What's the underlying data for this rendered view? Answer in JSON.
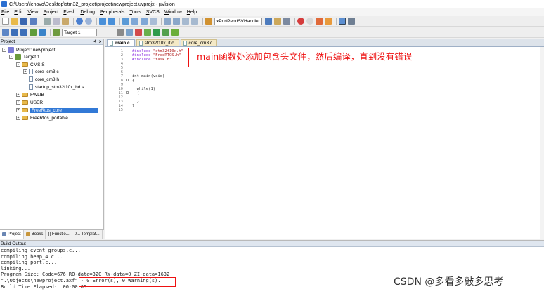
{
  "window": {
    "title": "C:\\Users\\lenovo\\Desktop\\stm32_project\\project\\newproject.uvprojx - µVision"
  },
  "menu": [
    "File",
    "Edit",
    "View",
    "Project",
    "Flash",
    "Debug",
    "Peripherals",
    "Tools",
    "SVCS",
    "Window",
    "Help"
  ],
  "toolbar": {
    "function_combo": "xPortPendSVHandler",
    "target_combo": "Target 1"
  },
  "project_panel": {
    "title": "Project",
    "pin": "4",
    "close": "x",
    "tree": [
      {
        "label": "Project: newproject",
        "level": 0,
        "kind": "project",
        "expander": "-"
      },
      {
        "label": "Target 1",
        "level": 1,
        "kind": "target",
        "expander": "-"
      },
      {
        "label": "CMSIS",
        "level": 2,
        "kind": "folder",
        "expander": "-"
      },
      {
        "label": "core_cm3.c",
        "level": 3,
        "kind": "file",
        "expander": "+"
      },
      {
        "label": "core_cm3.h",
        "level": 3,
        "kind": "file",
        "expander": ""
      },
      {
        "label": "startup_stm32f10x_hd.s",
        "level": 3,
        "kind": "file",
        "expander": ""
      },
      {
        "label": "FWLIB",
        "level": 2,
        "kind": "folder",
        "expander": "+"
      },
      {
        "label": "USER",
        "level": 2,
        "kind": "folder",
        "expander": "+"
      },
      {
        "label": "FreeRtos_core",
        "level": 2,
        "kind": "folder",
        "expander": "+",
        "selected": true
      },
      {
        "label": "FreeRtos_portable",
        "level": 2,
        "kind": "folder",
        "expander": "+"
      }
    ],
    "tabs": [
      "Project",
      "Books",
      "{} Functio...",
      "0... Templat..."
    ]
  },
  "editor": {
    "tabs": [
      {
        "label": "main.c",
        "active": true
      },
      {
        "label": "stm32f10x_it.c",
        "active": false
      },
      {
        "label": "core_cm3.c",
        "active": false
      }
    ],
    "line_numbers": [
      "1",
      "2",
      "3",
      "4",
      "5",
      "6",
      "7",
      "8",
      "9",
      "10",
      "11",
      "12",
      "13",
      "14",
      "15"
    ],
    "code": [
      {
        "pp": "#include",
        "str": " \"stm32f10x.h\""
      },
      {
        "pp": "#include",
        "str": " \"FreeRTOS.h\""
      },
      {
        "pp": "#include",
        "str": " \"task.h\""
      },
      {
        "text": ""
      },
      {
        "text": ""
      },
      {
        "text": ""
      },
      {
        "text": "int main(void)"
      },
      {
        "text": "{"
      },
      {
        "text": ""
      },
      {
        "text": "  while(1)"
      },
      {
        "text": "  {"
      },
      {
        "text": ""
      },
      {
        "text": "  }"
      },
      {
        "text": "}"
      },
      {
        "text": ""
      }
    ]
  },
  "annotation": "main函数处添加包含头文件，然后编译，直到没有错误",
  "build_output": {
    "title": "Build Output",
    "lines": [
      "compiling event_groups.c...",
      "compiling heap_4.c...",
      "compiling port.c...",
      "linking...",
      "Program Size: Code=676 RO-data=320 RW-data=0 ZI-data=1632",
      "\".\\Objects\\newproject.axf\" - 0 Error(s), 0 Warning(s).",
      "Build Time Elapsed:  00:00:05"
    ]
  },
  "watermark": "CSDN @多看多敲多思考",
  "colors": {
    "annotation": "#e11111",
    "selected": "#3279d6"
  }
}
